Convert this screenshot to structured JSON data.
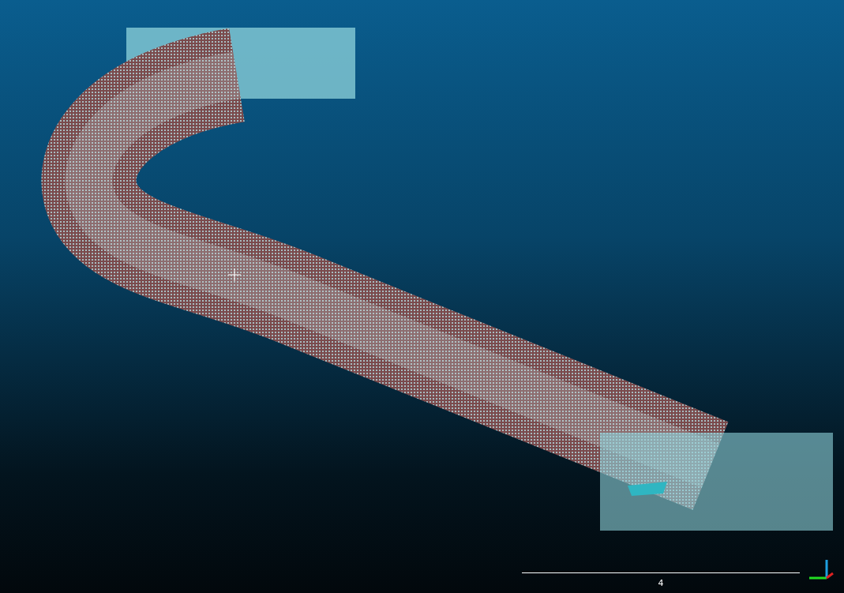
{
  "viewport": {
    "scale_bar": {
      "label": "4"
    }
  }
}
